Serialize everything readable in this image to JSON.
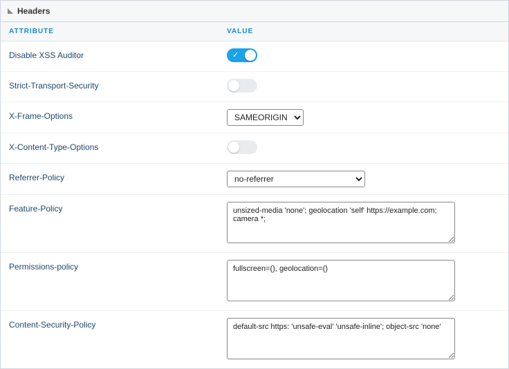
{
  "panel": {
    "title": "Headers"
  },
  "columns": {
    "attribute": "ATTRIBUTE",
    "value": "VALUE"
  },
  "rows": {
    "disable_xss": {
      "label": "Disable XSS Auditor",
      "on": true
    },
    "hsts": {
      "label": "Strict-Transport-Security",
      "on": false
    },
    "xframe": {
      "label": "X-Frame-Options",
      "selected": "SAMEORIGIN",
      "options": [
        "SAMEORIGIN"
      ]
    },
    "xcontenttype": {
      "label": "X-Content-Type-Options",
      "on": false
    },
    "referrer": {
      "label": "Referrer-Policy",
      "selected": "no-referrer",
      "options": [
        "no-referrer"
      ]
    },
    "feature": {
      "label": "Feature-Policy",
      "value": "unsized-media 'none'; geolocation 'self' https://example.com; camera *;"
    },
    "permissions": {
      "label": "Permissions-policy",
      "value": "fullscreen=(), geolocation=()"
    },
    "csp": {
      "label": "Content-Security-Policy",
      "value": "default-src https: 'unsafe-eval' 'unsafe-inline'; object-src 'none'"
    }
  }
}
